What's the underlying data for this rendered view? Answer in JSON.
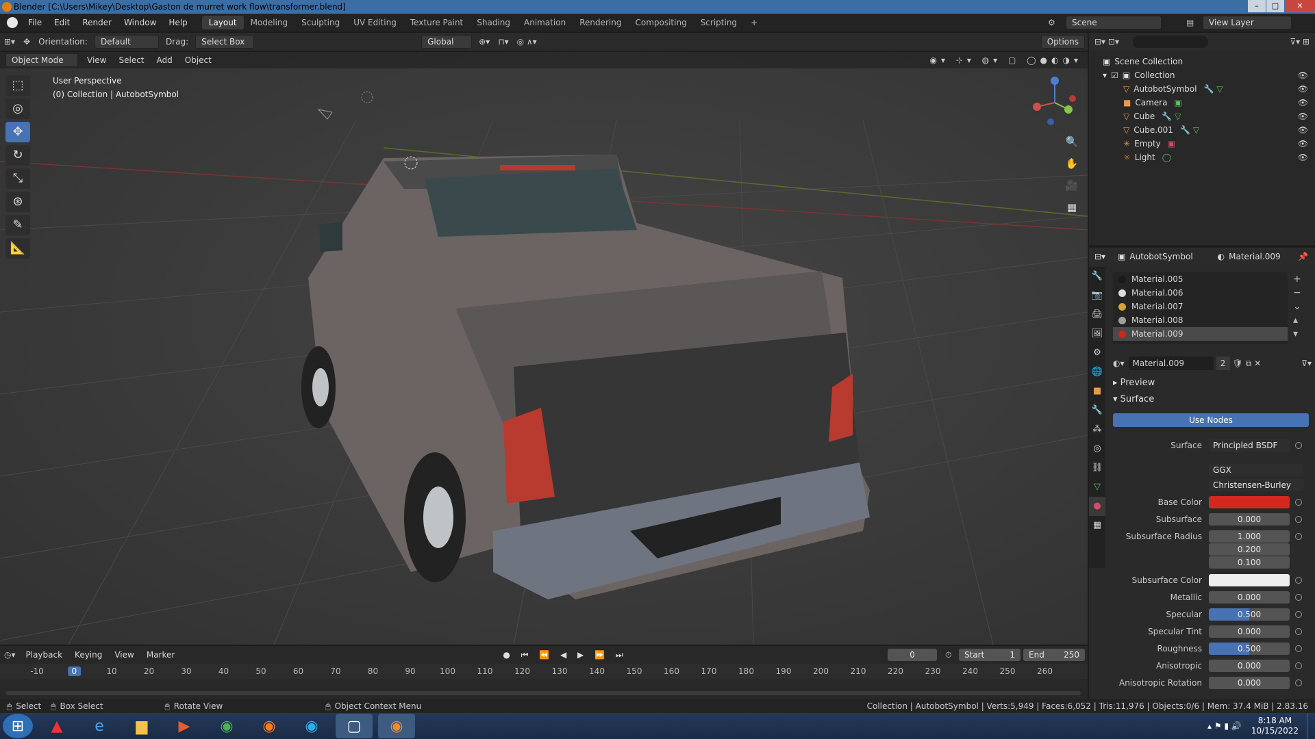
{
  "window": {
    "title": "Blender [C:\\Users\\Mikey\\Desktop\\Gaston de murret work flow\\transformer.blend]"
  },
  "menu": [
    "File",
    "Edit",
    "Render",
    "Window",
    "Help"
  ],
  "workspaces": [
    "Layout",
    "Modeling",
    "Sculpting",
    "UV Editing",
    "Texture Paint",
    "Shading",
    "Animation",
    "Rendering",
    "Compositing",
    "Scripting"
  ],
  "scene": {
    "label": "Scene",
    "view_layer": "View Layer"
  },
  "toolheader": {
    "orientation_label": "Orientation:",
    "orientation": "Default",
    "drag_label": "Drag:",
    "drag": "Select Box",
    "transform": "Global",
    "options": "Options"
  },
  "viewport_header": {
    "mode": "Object Mode",
    "menus": [
      "View",
      "Select",
      "Add",
      "Object"
    ]
  },
  "viewport_info": {
    "perspective": "User Perspective",
    "collection": "(0) Collection | AutobotSymbol"
  },
  "outliner": {
    "scene_collection": "Scene Collection",
    "collection": "Collection",
    "items": [
      "AutobotSymbol",
      "Camera",
      "Cube",
      "Cube.001",
      "Empty",
      "Light"
    ]
  },
  "props": {
    "object": "AutobotSymbol",
    "material": "Material.009",
    "slots": [
      "Material.005",
      "Material.006",
      "Material.007",
      "Material.008",
      "Material.009"
    ],
    "slot_colors": [
      "#1a1a1a",
      "#dcdcdc",
      "#d8a23a",
      "#a0a0a0",
      "#c8281e"
    ],
    "material_field": "Material.009",
    "users": "2",
    "preview_label": "Preview",
    "surface_label": "Surface",
    "use_nodes": "Use Nodes",
    "surface_shader_label": "Surface",
    "surface_shader": "Principled BSDF",
    "distribution": "GGX",
    "subsurface_method": "Christensen-Burley",
    "base_color_label": "Base Color",
    "base_color": "#d42820",
    "rows": [
      {
        "label": "Subsurface",
        "value": "0.000"
      },
      {
        "label": "Subsurface Radius",
        "value": "1.000"
      },
      {
        "label": "",
        "value": "0.200"
      },
      {
        "label": "",
        "value": "0.100"
      }
    ],
    "subsurface_color_label": "Subsurface Color",
    "rows2": [
      {
        "label": "Metallic",
        "value": "0.000"
      },
      {
        "label": "Specular",
        "value": "0.500"
      },
      {
        "label": "Specular Tint",
        "value": "0.000"
      },
      {
        "label": "Roughness",
        "value": "0.500"
      },
      {
        "label": "Anisotropic",
        "value": "0.000"
      },
      {
        "label": "Anisotropic Rotation",
        "value": "0.000"
      }
    ]
  },
  "timeline": {
    "menus": [
      "Playback",
      "Keying",
      "View",
      "Marker"
    ],
    "current": "0",
    "start_label": "Start",
    "start": "1",
    "end_label": "End",
    "end": "250",
    "ticks": [
      "-10",
      "0",
      "10",
      "20",
      "30",
      "40",
      "50",
      "60",
      "70",
      "80",
      "90",
      "100",
      "110",
      "120",
      "130",
      "140",
      "150",
      "160",
      "170",
      "180",
      "190",
      "200",
      "210",
      "220",
      "230",
      "240",
      "250",
      "260"
    ]
  },
  "status": {
    "select": "Select",
    "box_select": "Box Select",
    "rotate": "Rotate View",
    "context": "Object Context Menu",
    "stats": "Collection | AutobotSymbol | Verts:5,949 | Faces:6,052 | Tris:11,976 | Objects:0/6 | Mem: 37.4 MiB | 2.83.16"
  },
  "taskbar": {
    "time": "8:18 AM",
    "date": "10/15/2022"
  }
}
